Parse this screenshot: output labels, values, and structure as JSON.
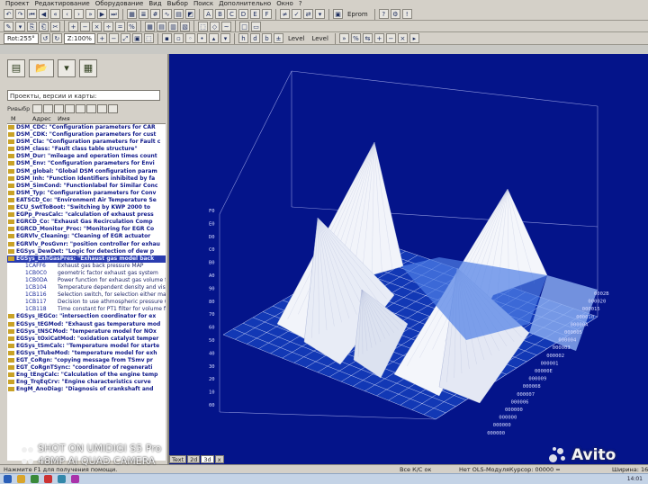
{
  "menubar": [
    "Проект",
    "Редактирование",
    "Оборудование",
    "Вид",
    "Выбор",
    "Поиск",
    "Дополнительно",
    "Окно",
    "?"
  ],
  "toolbar1": {
    "eprom_label": "Eprom"
  },
  "toolbar2": {
    "rotation": "Rot:255°",
    "zoom": "Z:100%",
    "level_label": "Level",
    "level_label2": "Level"
  },
  "left_panel": {
    "combo_label": "Проекты, версии и карты:",
    "filter_label": "Ривыбр",
    "col_headers": [
      "М",
      "Адрес",
      "Имя"
    ],
    "folders": [
      "DSM_CDC: \"Configuration parameters for CAR",
      "DSM_CDK: \"Configuration parameters for cust",
      "DSM_Cla: \"Configuration parameters for Fault c",
      "DSM_class: \"Fault class table structure\"",
      "DSM_Dur: \"mileage and operation times count",
      "DSM_Env: \"Configuration parameters for Envi",
      "DSM_global: \"Global DSM configuration param",
      "DSM_Inh: \"Function Identifiers inhibited by fa",
      "DSM_SimCond: \"Functionlabel for Similar Conc",
      "DSM_Typ: \"Configuration parameters for Conv",
      "EATSCD_Co: \"Environment Air Temperature Se",
      "ECU_SwtToBoot: \"Switching by KWP 2000 to",
      "EGPp_PresCalc: \"calculation of exhaust press",
      "EGRCD_Co: \"Exhaust Gas Recirculation Comp",
      "EGRCD_Monitor_Proc: \"Monitoring for EGR Co",
      "EGRVlv_Cleaning: \"Cleaning of EGR actuator",
      "EGRVlv_PosGvnr: \"position controller for exhau",
      "EGSys_DewDet: \"Logic for detection of dew p"
    ],
    "selected": "EGSys_ExhGasPres: \"Exhaust gas model back",
    "maps": [
      {
        "addr": "1CAFF6",
        "desc": "Exhaust gas back pressure MAP"
      },
      {
        "addr": "1CB0C0",
        "desc": "geometric factor exhaust gas system"
      },
      {
        "addr": "1CB0DA",
        "desc": "Power function for exhaust gas volume fl"
      },
      {
        "addr": "1CB104",
        "desc": "Temperature dependent density and visc"
      },
      {
        "addr": "1CB116",
        "desc": "Selection switch, for selection either map"
      },
      {
        "addr": "1CB117",
        "desc": "Decision to use athmospheric pressure (-"
      },
      {
        "addr": "1CB118",
        "desc": "Time constant for PT1 filter for volume flo"
      }
    ],
    "folders2": [
      "EGSys_IEGCo: \"intersection coordinator for ex",
      "EGSys_tEGMod: \"Exhaust gas temperature mod",
      "EGSys_tNSCMod: \"temperature model for NOx",
      "EGSys_tOxiCatMod: \"oxidation catalyst temper",
      "EGSys_tSmCalc: \"Temperature model for starte",
      "EGSys_tTubeMod: \"temperature model for exh",
      "EGT_CoRgn: \"copying message from TSmv pr",
      "EGT_CoRgnTSync: \"coordinator of regenerati",
      "Eng_tEngCalc: \"Calculation of the engine temp",
      "Eng_TrqEqCrv: \"Engine characteristics curve",
      "EngM_AnoDiag: \"Diagnosis of crankshaft and"
    ]
  },
  "plot": {
    "z_ticks": [
      "F0",
      "E0",
      "D0",
      "C0",
      "B0",
      "A0",
      "90",
      "80",
      "70",
      "60",
      "50",
      "40",
      "30",
      "20",
      "10",
      "00"
    ],
    "right_ticks": [
      "0002B",
      "000020",
      "000015",
      "000010",
      "00000A",
      "000005",
      "000004",
      "000003",
      "000002",
      "000001",
      "00000E",
      "000009",
      "000008",
      "000007",
      "000006",
      "000000",
      "000000",
      "000000",
      "000000"
    ]
  },
  "tabs": [
    "Text",
    "2d",
    "3d",
    "x"
  ],
  "status": {
    "help": "Нажмите F1 для получения помощи.",
    "ok": "Все К/С ок",
    "module": "Нет OLS-Модуля",
    "cursor": "Курсор: 00000 =",
    "size": "Ширина: 16"
  },
  "taskbar": {
    "clock": "14:01"
  },
  "watermark": {
    "line1": "SHOT ON UMIDIGI S5 Pro",
    "line2": "48MP AI QUAD CAMERA",
    "brand": "Avito"
  }
}
